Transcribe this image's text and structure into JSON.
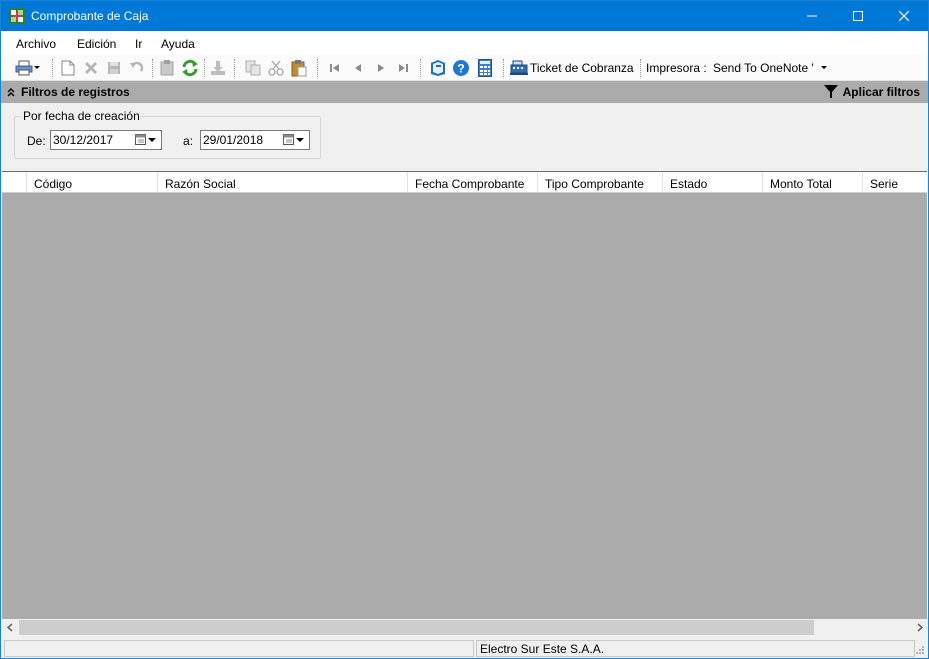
{
  "window": {
    "title": "Comprobante de Caja"
  },
  "menu": {
    "items": [
      "Archivo",
      "Edición",
      "Ir",
      "Ayuda"
    ]
  },
  "toolbar": {
    "ticket_label": "Ticket de Cobranza",
    "printer_label": "Impresora :",
    "printer_value": "Send To OneNote '"
  },
  "filters": {
    "title": "Filtros de registros",
    "apply_label": "Aplicar filtros",
    "group_title": "Por fecha de creación",
    "from_label": "De:",
    "from_value": "30/12/2017",
    "to_label": "a:",
    "to_value": "29/01/2018"
  },
  "grid": {
    "columns": [
      "Código",
      "Razón Social",
      "Fecha Comprobante",
      "Tipo Comprobante",
      "Estado",
      "Monto Total",
      "Serie"
    ],
    "rows": []
  },
  "status": {
    "company": "Electro Sur Este S.A.A."
  },
  "colors": {
    "titlebar": "#0078d7",
    "grid_background": "#ababab",
    "filters_bar": "#ababab"
  }
}
